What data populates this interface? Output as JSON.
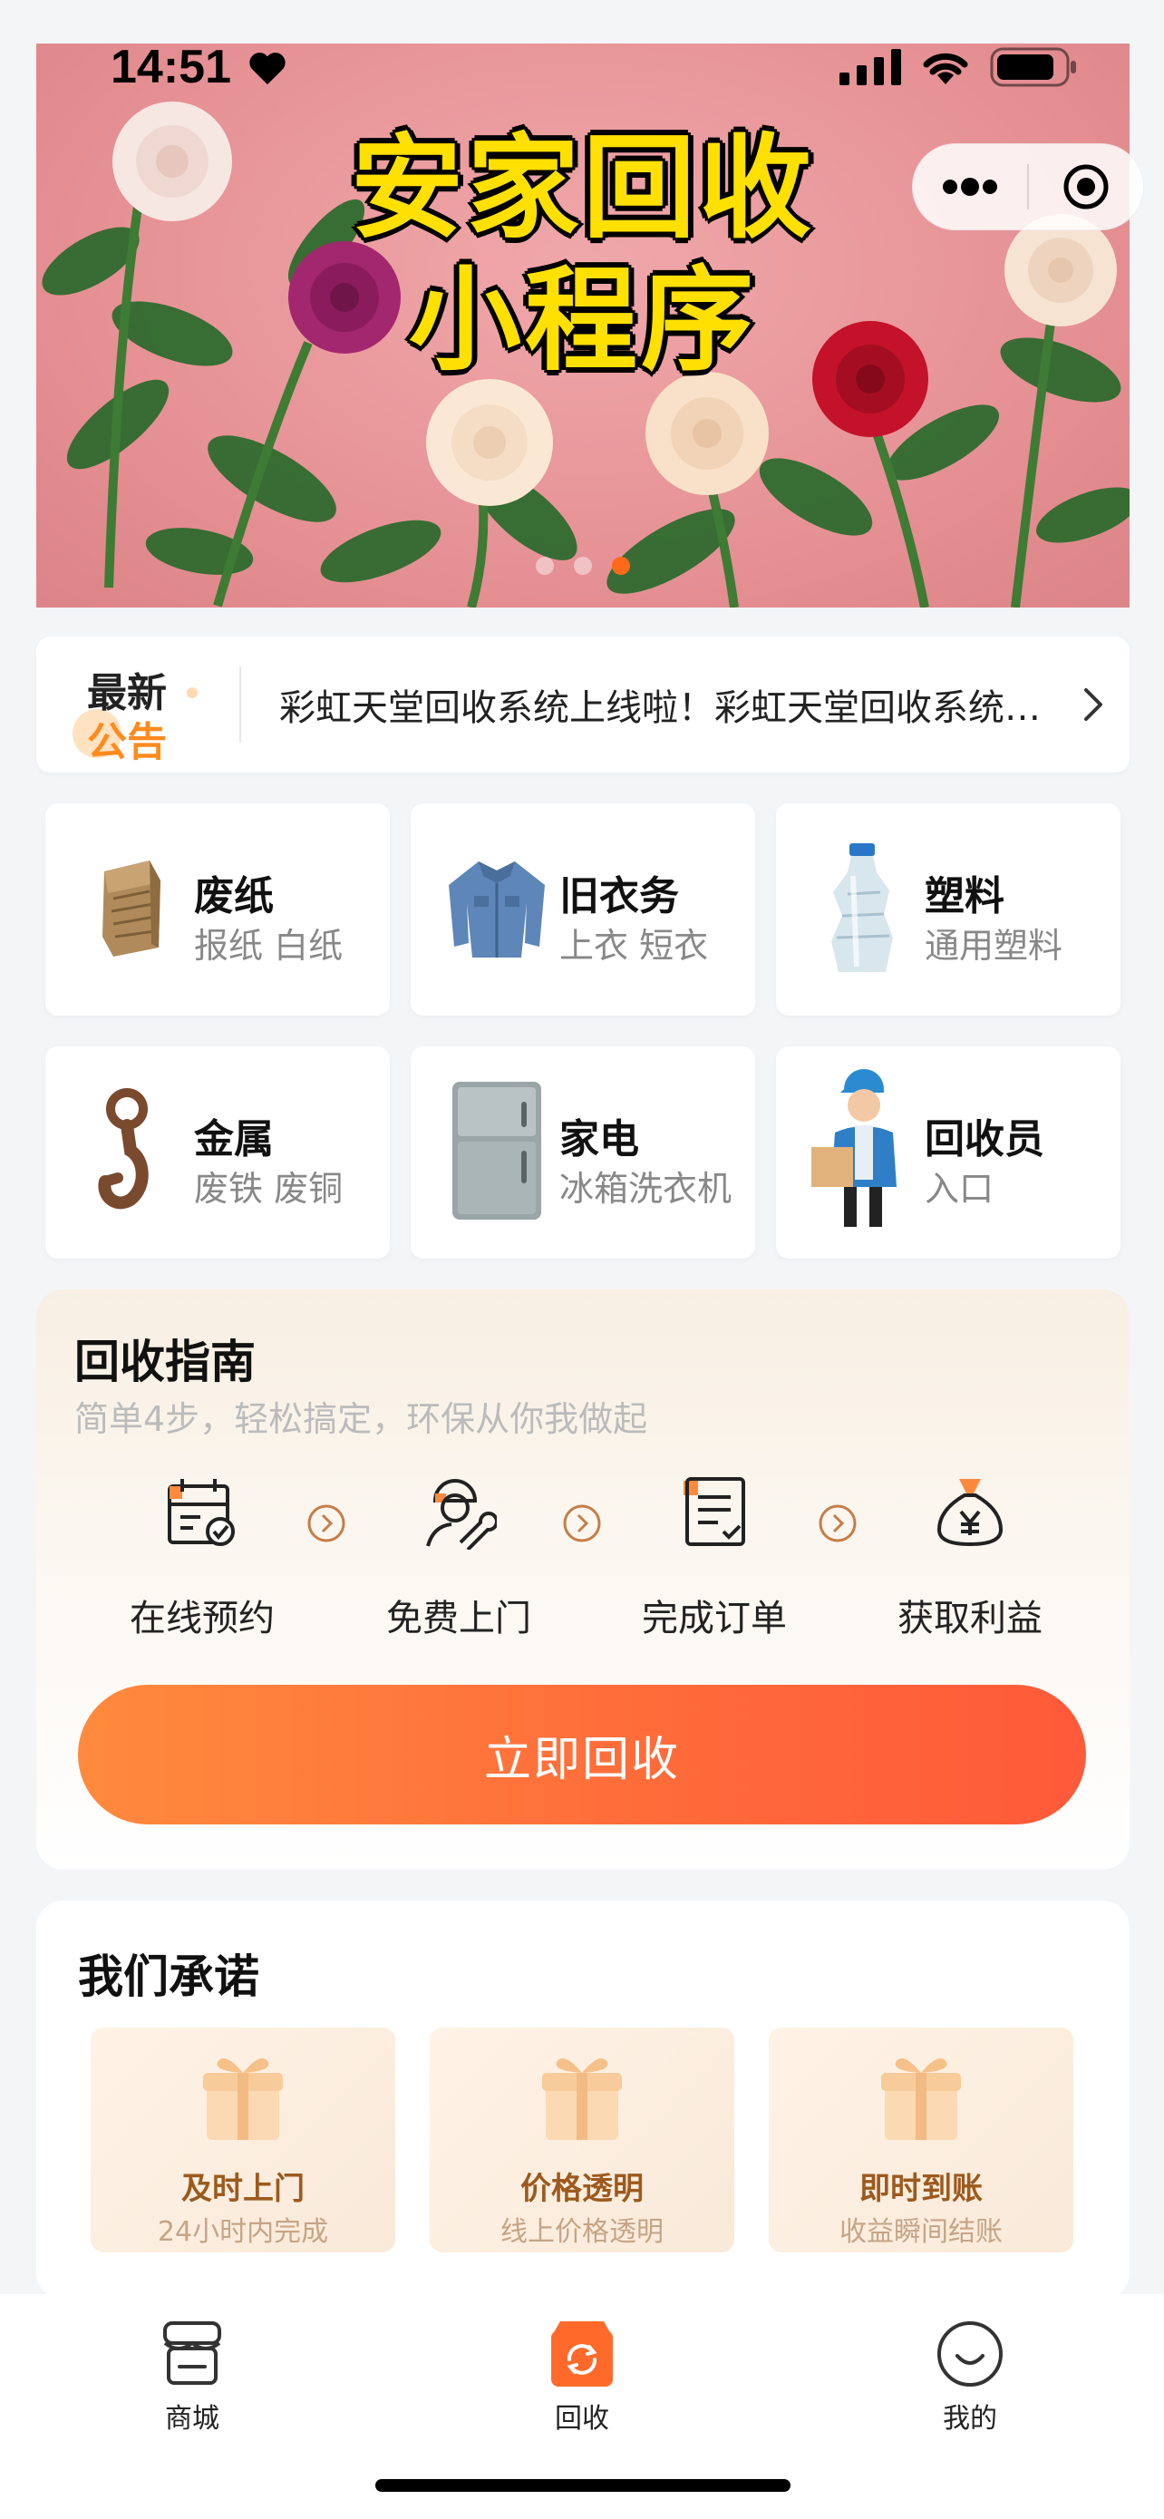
{
  "status_bar": {
    "time": "14:51"
  },
  "banner": {
    "title_line1": "安家回收",
    "title_line2": "小程序",
    "dot_count": 3,
    "active_dot": 3
  },
  "notice": {
    "badge_top": "最新",
    "badge_bottom": "公告",
    "text": "彩虹天堂回收系统上线啦！彩虹天堂回收系统上线啦！"
  },
  "categories": [
    {
      "name": "废纸",
      "sub": "报纸 白纸",
      "icon": "cardboard-icon"
    },
    {
      "name": "旧衣务",
      "sub": "上衣 短衣",
      "icon": "shirt-icon"
    },
    {
      "name": "塑料",
      "sub": "通用塑料",
      "icon": "bottle-icon"
    },
    {
      "name": "金属",
      "sub": "废铁 废铜",
      "icon": "hook-icon"
    },
    {
      "name": "家电",
      "sub": "冰箱洗衣机",
      "icon": "fridge-icon"
    },
    {
      "name": "回收员",
      "sub": "入口",
      "icon": "courier-icon"
    }
  ],
  "guide": {
    "title": "回收指南",
    "subtitle": "简单4步，轻松搞定，环保从你我做起",
    "steps": [
      {
        "label": "在线预约",
        "icon": "calendar-check-icon"
      },
      {
        "label": "免费上门",
        "icon": "worker-wrench-icon"
      },
      {
        "label": "完成订单",
        "icon": "document-check-icon"
      },
      {
        "label": "获取利益",
        "icon": "money-bag-icon"
      }
    ],
    "cta": "立即回收"
  },
  "promise": {
    "title": "我们承诺",
    "cards": [
      {
        "title": "及时上门",
        "sub": "24小时内完成"
      },
      {
        "title": "价格透明",
        "sub": "线上价格透明"
      },
      {
        "title": "即时到账",
        "sub": "收益瞬间结账"
      }
    ]
  },
  "tabbar": {
    "items": [
      {
        "label": "商城",
        "icon": "store-icon"
      },
      {
        "label": "回收",
        "icon": "recycle-box-icon",
        "active": true
      },
      {
        "label": "我的",
        "icon": "smile-icon"
      }
    ]
  },
  "colors": {
    "accent": "#ff6a3a",
    "banner_title": "#ffe000",
    "notice_orange": "#ff8a1e",
    "promise_text": "#9c5a1e"
  }
}
